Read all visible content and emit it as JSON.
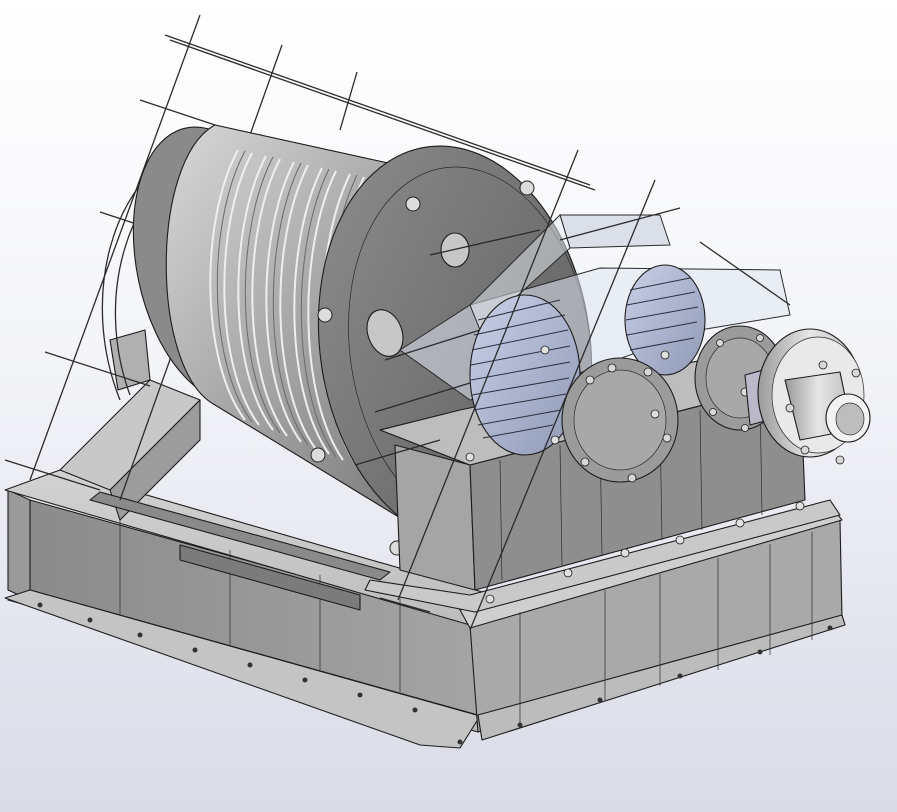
{
  "model": {
    "subject": "drum-winch-assembly",
    "components": [
      {
        "id": "base-frame",
        "kind": "welded-steel-frame"
      },
      {
        "id": "rope-drum",
        "kind": "grooved-cylindrical-drum"
      },
      {
        "id": "drum-flange",
        "kind": "bolted-end-flange"
      },
      {
        "id": "gearbox",
        "kind": "spur-gear-reducer"
      },
      {
        "id": "gear-cover",
        "kind": "transparent-guard"
      },
      {
        "id": "output-coupling",
        "kind": "shaft-coupling"
      },
      {
        "id": "cage-guard",
        "kind": "wire-mesh-guard"
      }
    ],
    "colors": {
      "background_top": "#ffffff",
      "background_bottom": "#d9dbe6",
      "steel_light": "#c9c9c9",
      "steel_mid": "#9a9a9a",
      "steel_dark": "#5e5e5e",
      "gear_tint": "#b4bed8",
      "glass": "#dfe6f0",
      "edge": "#1c1c1c"
    }
  }
}
